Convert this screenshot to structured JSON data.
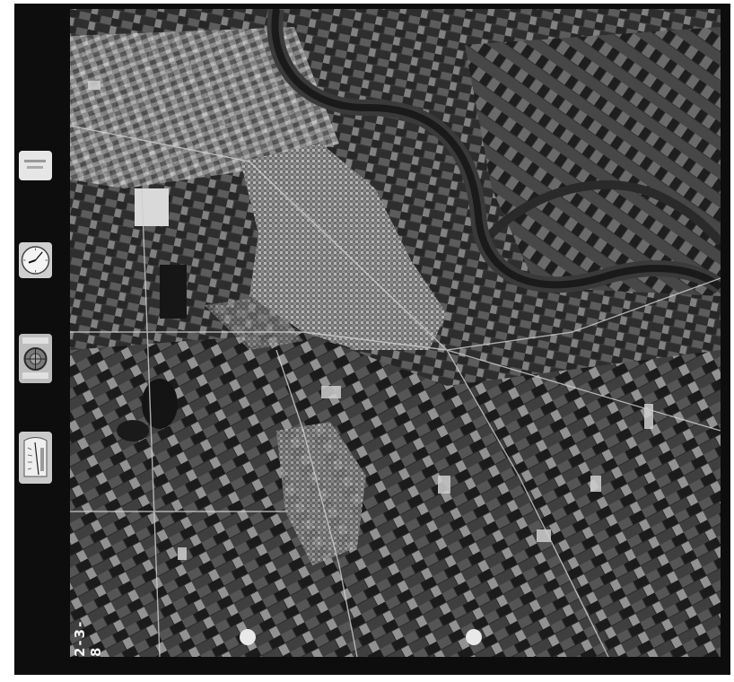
{
  "frame": {
    "strip_code": "2-3-8",
    "instruments": {
      "label_card_text": "",
      "clock": {
        "hour_hand_deg": 250,
        "minute_hand_deg": 40
      },
      "compass_text": "",
      "level_scale_text": ""
    }
  },
  "map": {
    "type": "aerial-photograph",
    "colors": {
      "frame": "#0d0d0d",
      "river": "#3a3a3a",
      "urban": "#9a9a9a",
      "fields_dark": "#202020",
      "fields_light": "#bdbdbd"
    }
  }
}
